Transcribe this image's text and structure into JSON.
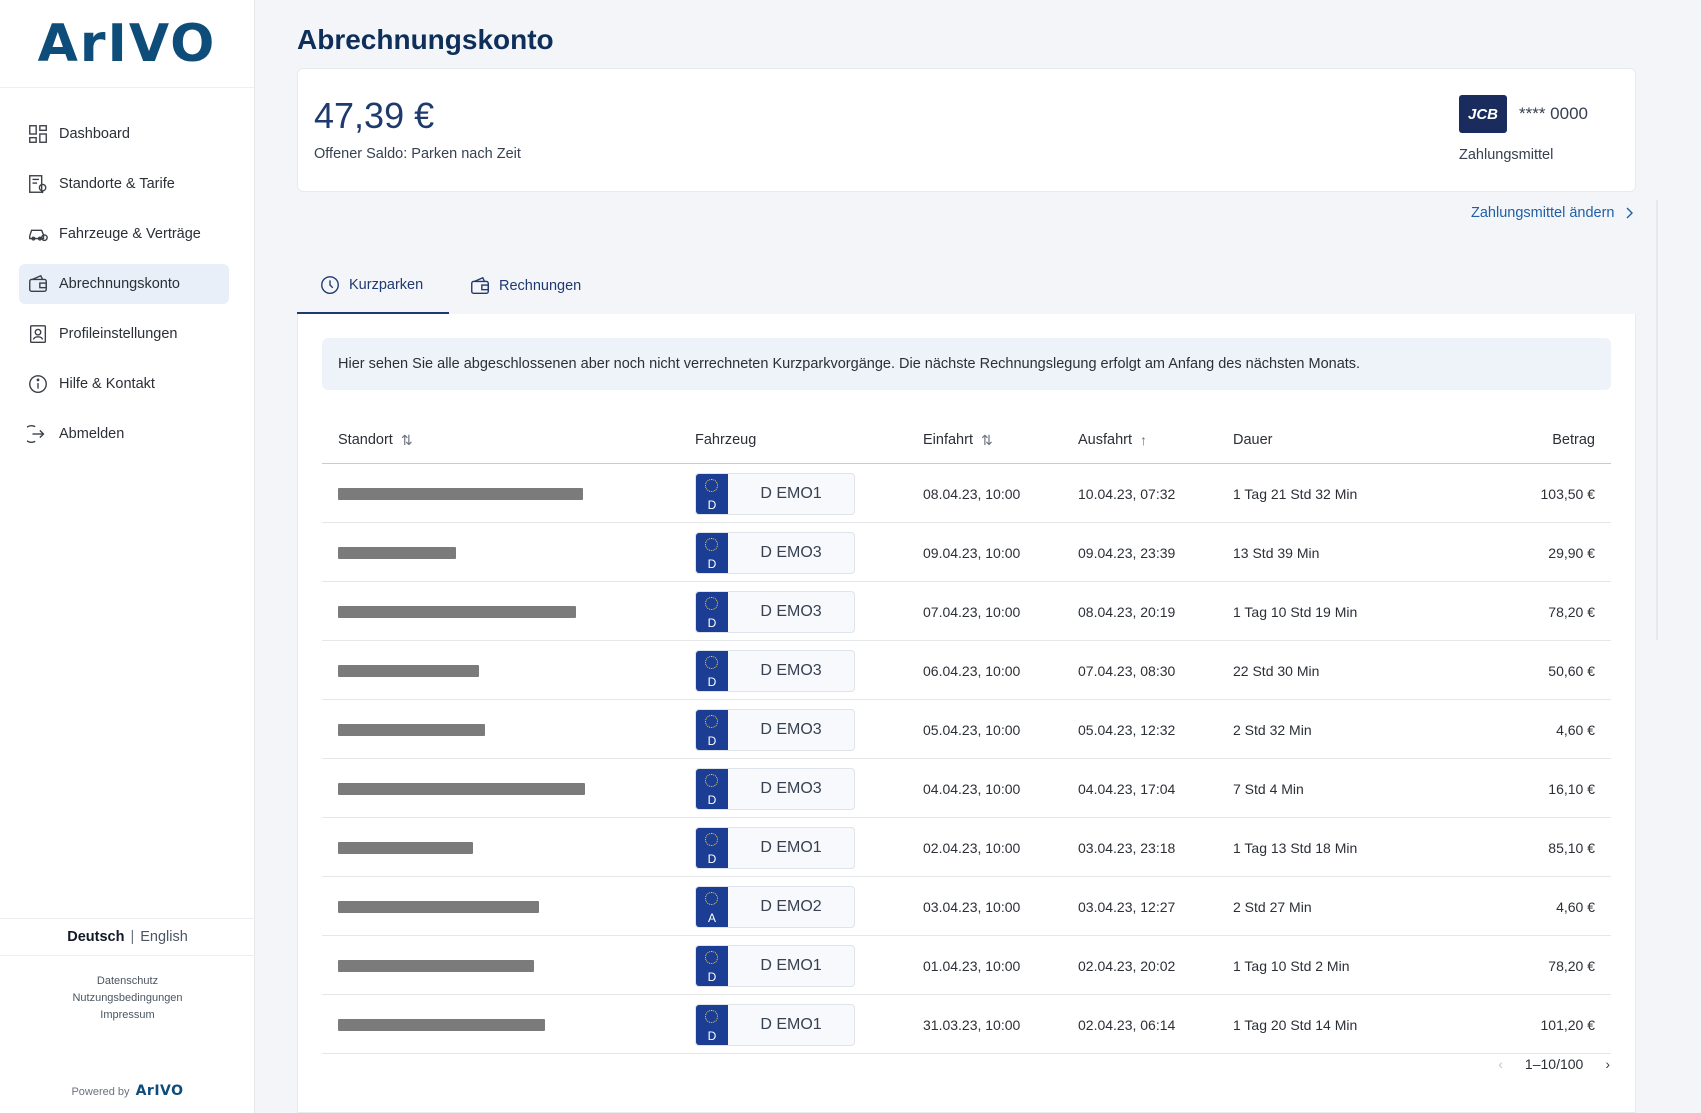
{
  "brand": {
    "logo": "ArIVO",
    "powered_prefix": "Powered by",
    "powered_logo": "ArIVO"
  },
  "sidebar": {
    "items": [
      {
        "label": "Dashboard",
        "icon": "dashboard-icon"
      },
      {
        "label": "Standorte & Tarife",
        "icon": "location-tariff-icon"
      },
      {
        "label": "Fahrzeuge & Verträge",
        "icon": "car-contract-icon"
      },
      {
        "label": "Abrechnungskonto",
        "icon": "wallet-icon"
      },
      {
        "label": "Profileinstellungen",
        "icon": "profile-icon"
      },
      {
        "label": "Hilfe & Kontakt",
        "icon": "info-icon"
      },
      {
        "label": "Abmelden",
        "icon": "logout-icon"
      }
    ],
    "active_index": 3,
    "lang": {
      "active": "Deutsch",
      "separator": "|",
      "inactive": "English"
    },
    "legal": {
      "privacy": "Datenschutz",
      "terms": "Nutzungsbedingungen",
      "imprint": "Impressum"
    }
  },
  "page": {
    "title": "Abrechnungskonto",
    "balance": {
      "amount": "47,39 €",
      "label": "Offener Saldo: Parken nach Zeit"
    },
    "payment": {
      "brand": "JCB",
      "masked": "**** 0000",
      "label": "Zahlungsmittel",
      "change_link": "Zahlungsmittel ändern"
    },
    "tabs": [
      {
        "label": "Kurzparken",
        "icon": "clock-icon"
      },
      {
        "label": "Rechnungen",
        "icon": "wallet-icon"
      }
    ],
    "info": "Hier sehen Sie alle abgeschlossenen aber noch nicht verrechneten Kurzparkvorgänge. Die nächste Rechnungslegung erfolgt am Anfang des nächsten Monats.",
    "table": {
      "headers": {
        "standort": "Standort",
        "fahrzeug": "Fahrzeug",
        "einfahrt": "Einfahrt",
        "ausfahrt": "Ausfahrt",
        "dauer": "Dauer",
        "betrag": "Betrag"
      },
      "sort_icons": {
        "standort": "⇅",
        "einfahrt": "⇅",
        "ausfahrt": "↑"
      },
      "rows": [
        {
          "country": "D",
          "plate": "D EMO1",
          "einfahrt": "08.04.23, 10:00",
          "ausfahrt": "10.04.23, 07:32",
          "dauer": "1 Tag 21 Std 32 Min",
          "betrag": "103,50 €"
        },
        {
          "country": "D",
          "plate": "D EMO3",
          "einfahrt": "09.04.23, 10:00",
          "ausfahrt": "09.04.23, 23:39",
          "dauer": "13 Std 39 Min",
          "betrag": "29,90 €"
        },
        {
          "country": "D",
          "plate": "D EMO3",
          "einfahrt": "07.04.23, 10:00",
          "ausfahrt": "08.04.23, 20:19",
          "dauer": "1 Tag 10 Std 19 Min",
          "betrag": "78,20 €"
        },
        {
          "country": "D",
          "plate": "D EMO3",
          "einfahrt": "06.04.23, 10:00",
          "ausfahrt": "07.04.23, 08:30",
          "dauer": "22 Std 30 Min",
          "betrag": "50,60 €"
        },
        {
          "country": "D",
          "plate": "D EMO3",
          "einfahrt": "05.04.23, 10:00",
          "ausfahrt": "05.04.23, 12:32",
          "dauer": "2 Std 32 Min",
          "betrag": "4,60 €"
        },
        {
          "country": "D",
          "plate": "D EMO3",
          "einfahrt": "04.04.23, 10:00",
          "ausfahrt": "04.04.23, 17:04",
          "dauer": "7 Std 4 Min",
          "betrag": "16,10 €"
        },
        {
          "country": "D",
          "plate": "D EMO1",
          "einfahrt": "02.04.23, 10:00",
          "ausfahrt": "03.04.23, 23:18",
          "dauer": "1 Tag 13 Std 18 Min",
          "betrag": "85,10 €"
        },
        {
          "country": "A",
          "plate": "D EMO2",
          "einfahrt": "03.04.23, 10:00",
          "ausfahrt": "03.04.23, 12:27",
          "dauer": "2 Std 27 Min",
          "betrag": "4,60 €"
        },
        {
          "country": "D",
          "plate": "D EMO1",
          "einfahrt": "01.04.23, 10:00",
          "ausfahrt": "02.04.23, 20:02",
          "dauer": "1 Tag 10 Std 2 Min",
          "betrag": "78,20 €"
        },
        {
          "country": "D",
          "plate": "D EMO1",
          "einfahrt": "31.03.23, 10:00",
          "ausfahrt": "02.04.23, 06:14",
          "dauer": "1 Tag 20 Std 14 Min",
          "betrag": "101,20 €"
        }
      ]
    },
    "pager": {
      "range": "1–10/100",
      "prev": "‹",
      "next": "›"
    }
  },
  "colors": {
    "brand": "#0e4d7a",
    "title": "#0e2f5a",
    "link": "#1f5fa8",
    "active_nav": "#e9eff8",
    "plate_blue": "#1b3d93"
  }
}
